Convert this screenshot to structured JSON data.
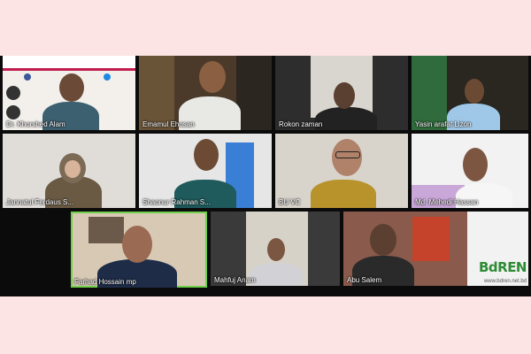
{
  "participants": [
    {
      "name": "Dr. Khorshed Alam"
    },
    {
      "name": "Emamul Ehosan"
    },
    {
      "name": "Rokon zaman"
    },
    {
      "name": "Yasin arafat Lizon"
    },
    {
      "name": "Jannatul Ferdaus S..."
    },
    {
      "name": "Shaonur Rahman S..."
    },
    {
      "name": "BU VC"
    },
    {
      "name": "Md. Mehedi Hassan"
    },
    {
      "name": "Farhad Hossain mp"
    },
    {
      "name": "Mahfuj Anam"
    },
    {
      "name": "Abu Salem"
    }
  ],
  "branding": {
    "logo_text": "BdREN",
    "url": "www.bdren.net.bd"
  },
  "colors": {
    "background": "#fce4e4",
    "active_speaker_border": "#6fd14a",
    "brand": "#2e8b35"
  }
}
